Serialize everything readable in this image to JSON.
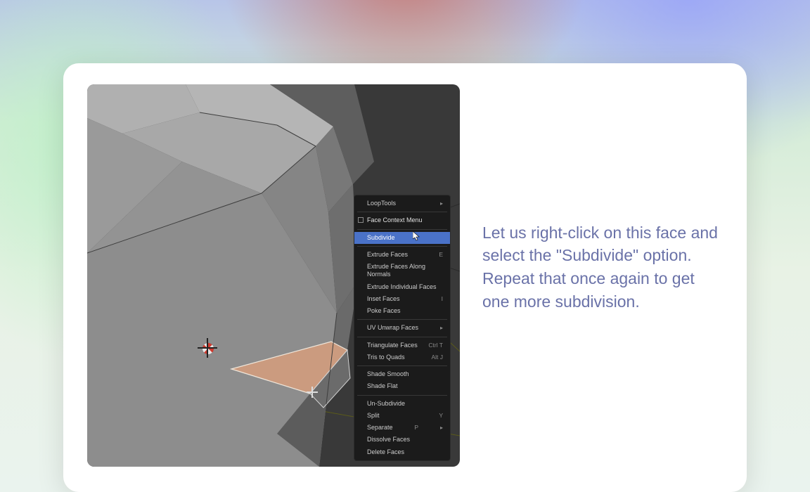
{
  "instruction_text": "Let us right-click on this face and select the \"Subdivide\" option. Repeat that once again to get one more subdivision.",
  "context_menu": {
    "loop_tools": "LoopTools",
    "header": "Face Context Menu",
    "subdivide": "Subdivide",
    "extrude_faces": {
      "label": "Extrude Faces",
      "shortcut": "E"
    },
    "extrude_normals": "Extrude Faces Along Normals",
    "extrude_individual": "Extrude Individual Faces",
    "inset_faces": {
      "label": "Inset Faces",
      "shortcut": "I"
    },
    "poke_faces": "Poke Faces",
    "uv_unwrap": "UV Unwrap Faces",
    "triangulate": {
      "label": "Triangulate Faces",
      "shortcut": "Ctrl T"
    },
    "tris_to_quads": {
      "label": "Tris to Quads",
      "shortcut": "Alt J"
    },
    "shade_smooth": "Shade Smooth",
    "shade_flat": "Shade Flat",
    "un_subdivide": "Un-Subdivide",
    "split": {
      "label": "Split",
      "shortcut": "Y"
    },
    "separate": {
      "label": "Separate",
      "shortcut": "P"
    },
    "dissolve": "Dissolve Faces",
    "delete": "Delete Faces"
  }
}
